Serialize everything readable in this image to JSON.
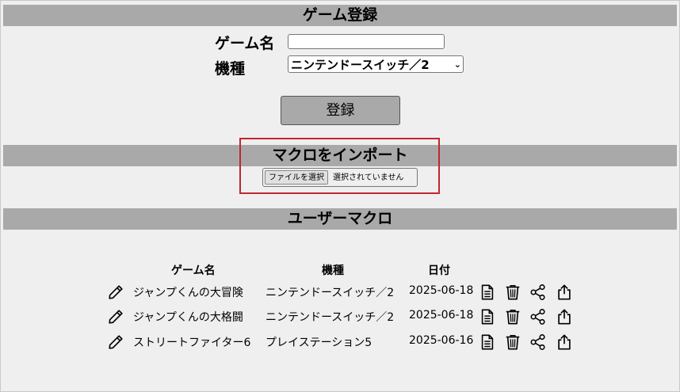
{
  "register": {
    "heading": "ゲーム登録",
    "name_label": "ゲーム名",
    "name_value": "",
    "platform_label": "機種",
    "platform_selected": "ニンテンドースイッチ／2",
    "submit_label": "登録"
  },
  "import": {
    "heading": "マクロをインポート",
    "file_button_label": "ファイルを選択",
    "file_status": "選択されていません"
  },
  "macros": {
    "heading": "ユーザーマクロ",
    "columns": [
      "ゲーム名",
      "機種",
      "日付"
    ],
    "rows": [
      {
        "game": "ジャンプくんの大冒険",
        "platform": "ニンテンドースイッチ／2",
        "date": "2025-06-18"
      },
      {
        "game": "ジャンプくんの大格闘",
        "platform": "ニンテンドースイッチ／2",
        "date": "2025-06-18"
      },
      {
        "game": "ストリートファイター6",
        "platform": "プレイステーション5",
        "date": "2025-06-16"
      }
    ],
    "row_icons": [
      "pencil-icon",
      "document-icon",
      "trash-icon",
      "share-icon",
      "export-icon"
    ]
  },
  "colors": {
    "background": "#efefef",
    "section_bar": "#a9a9a9",
    "highlight": "#c1272d"
  }
}
